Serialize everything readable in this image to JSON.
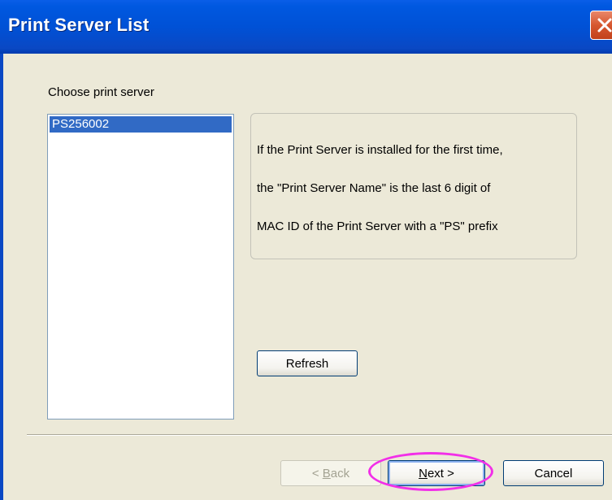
{
  "window": {
    "title": "Print Server List",
    "title_bar_color": "#0051d6",
    "close_icon": "close-icon"
  },
  "server_list": {
    "label": "Choose print server",
    "items": [
      "PS256002"
    ],
    "selected_index": 0,
    "selection_color": "#316ac5"
  },
  "info": {
    "lines": [
      "If the Print Server is installed for the first time,",
      "the \"Print Server Name\" is the last 6 digit of",
      "MAC ID of the Print Server with a \"PS\" prefix"
    ]
  },
  "buttons": {
    "refresh": "Refresh",
    "back_mnemonic": "B",
    "back_rest": "ack",
    "back_prefix": "< ",
    "next_mnemonic": "N",
    "next_rest": "ext >",
    "cancel": "Cancel"
  },
  "annotation": {
    "highlight_color": "#f22fe8",
    "highlighted": "next-button"
  }
}
